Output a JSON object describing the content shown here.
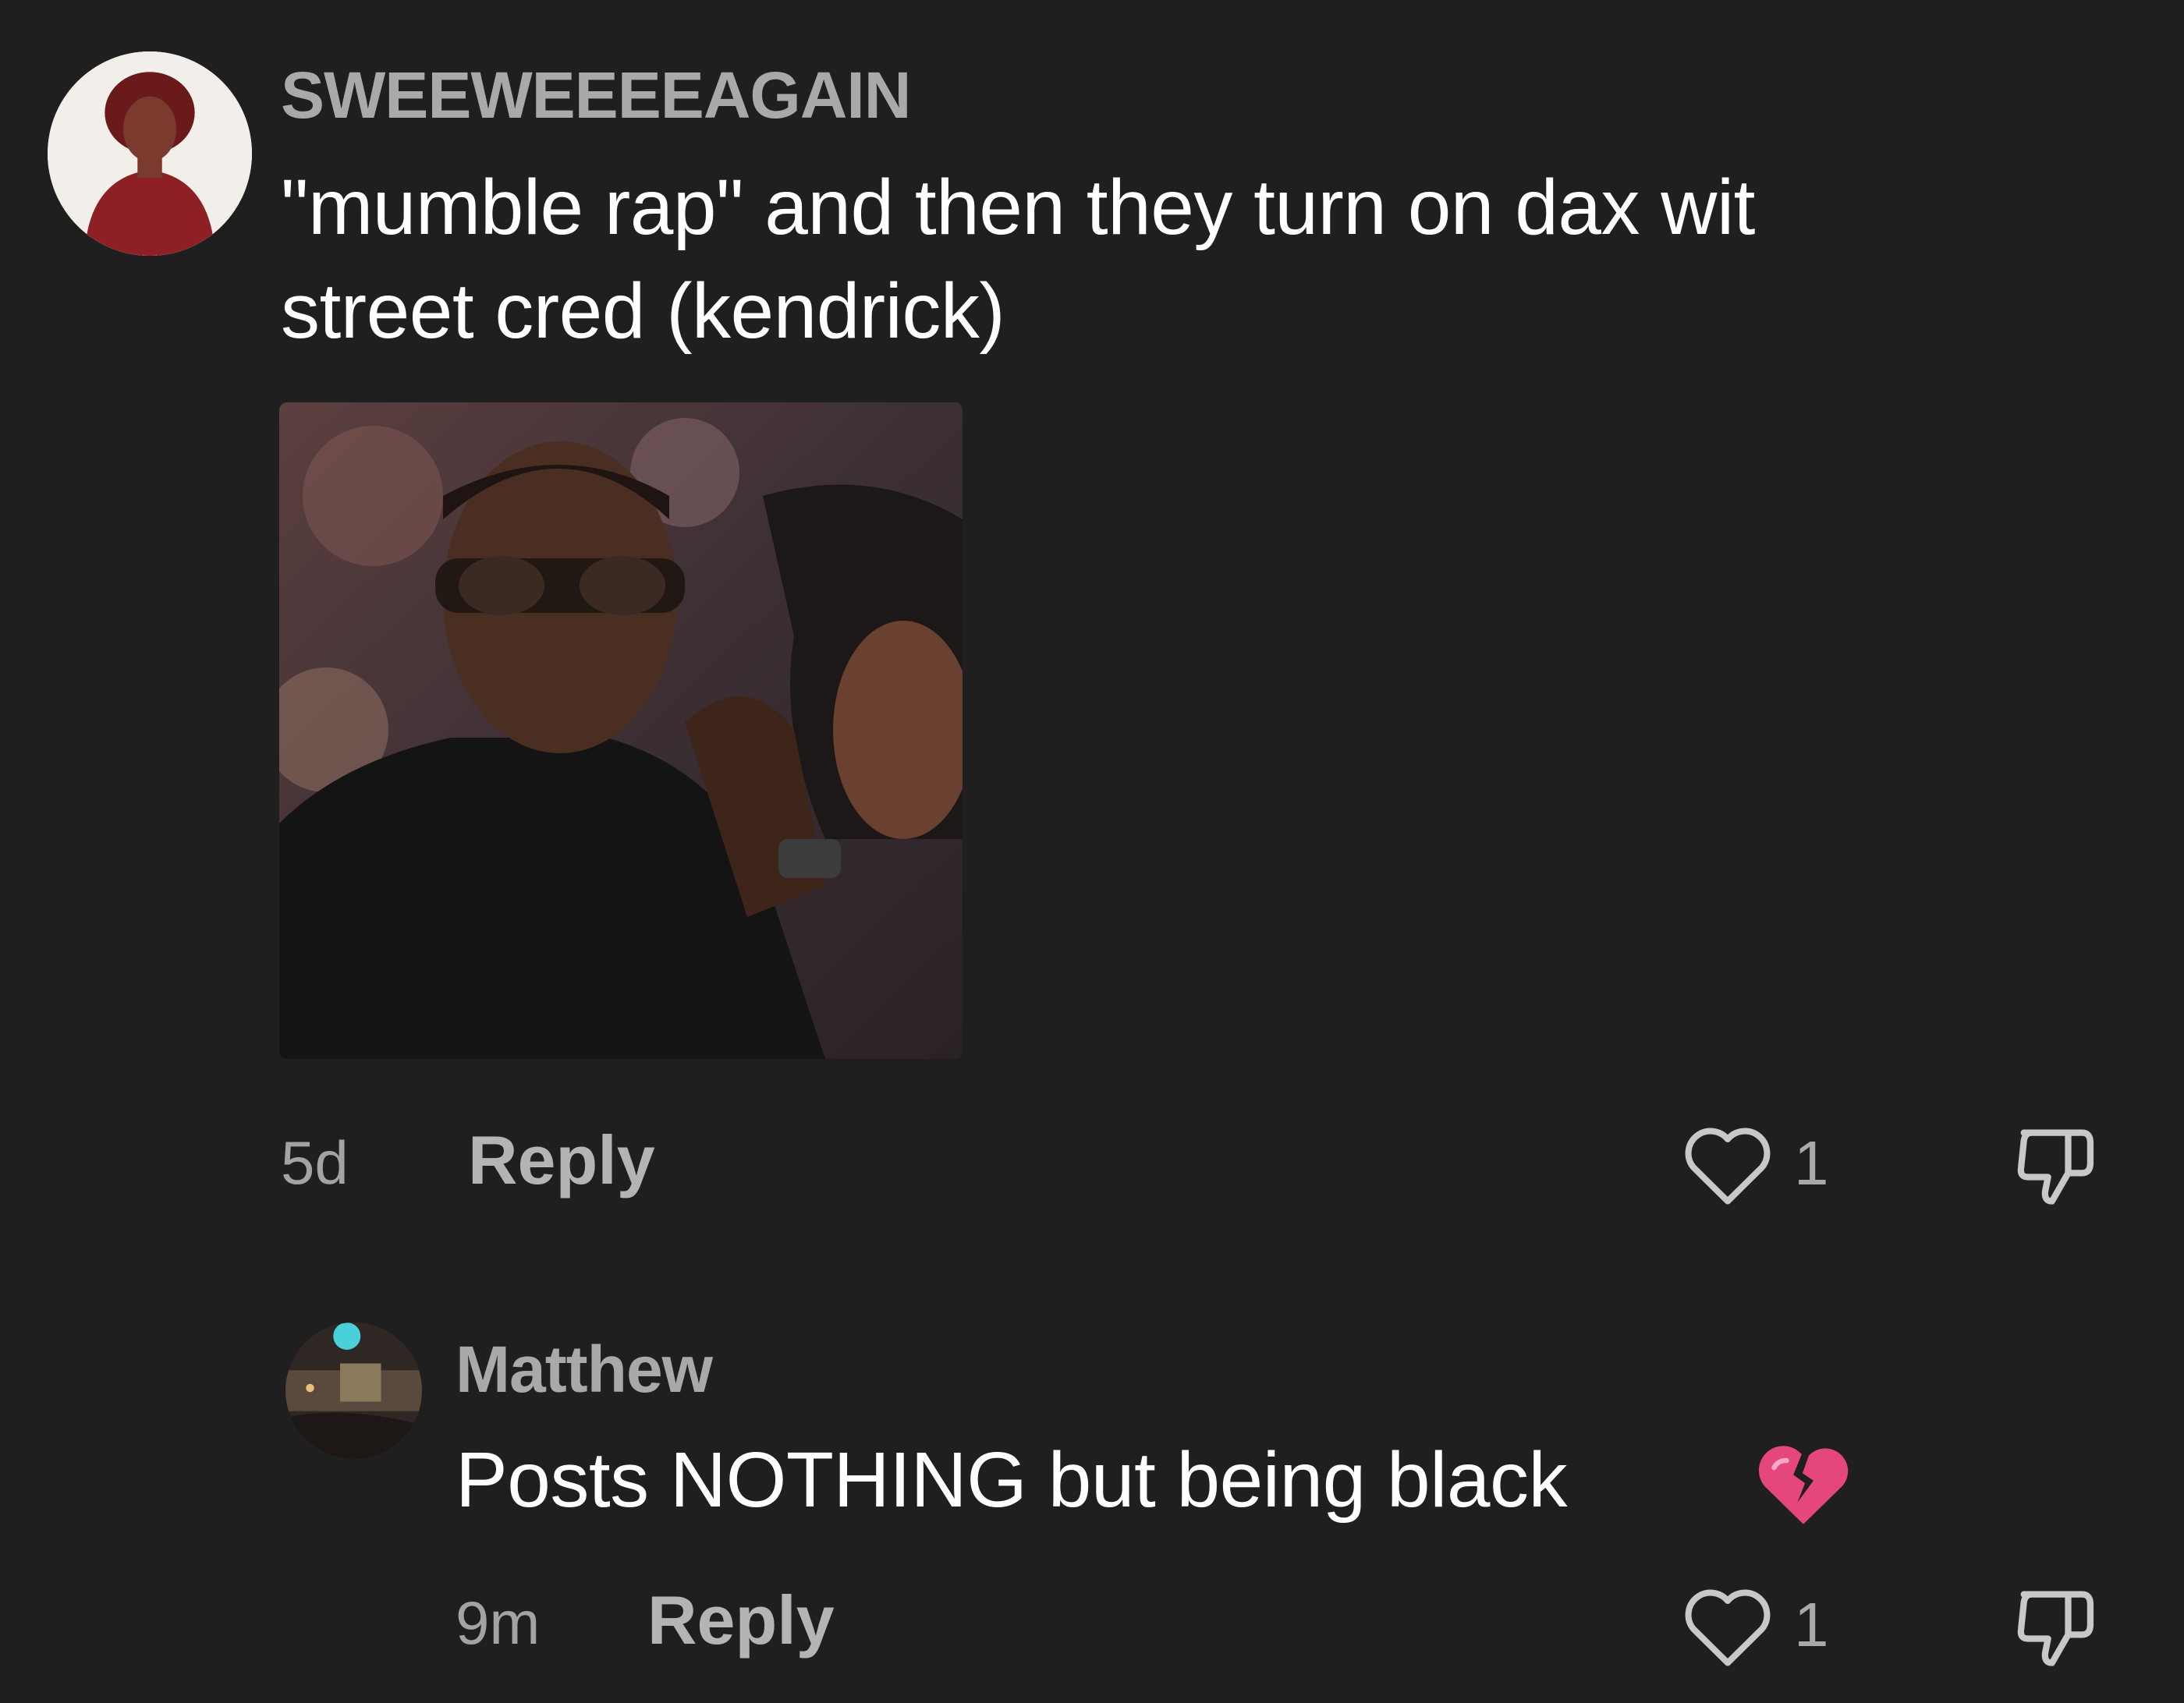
{
  "comment": {
    "username": "SWEEWEEEEAGAIN",
    "text_line1": "\"mumble rap\" and then they turn on dax wit",
    "text_line2": "street cred (kendrick)",
    "time": "5d",
    "reply_label": "Reply",
    "like_count": "1",
    "avatar_icon": "profile-photo",
    "attachment_icon": "photo-attachment"
  },
  "reply": {
    "username": "Matthew",
    "text": "Posts NOTHING but being black",
    "emoji": "broken-heart-emoji",
    "time": "9m",
    "reply_label": "Reply",
    "like_count": "1",
    "avatar_icon": "profile-photo"
  },
  "icons": {
    "like": "heart-outline-icon",
    "dislike": "thumbs-down-icon"
  },
  "colors": {
    "background": "#1f1f1f",
    "username": "#a9a9a9",
    "text": "#ffffff",
    "meta": "#a3a3a3",
    "icon": "#c8c8c8",
    "emoji": "#e5467e"
  }
}
